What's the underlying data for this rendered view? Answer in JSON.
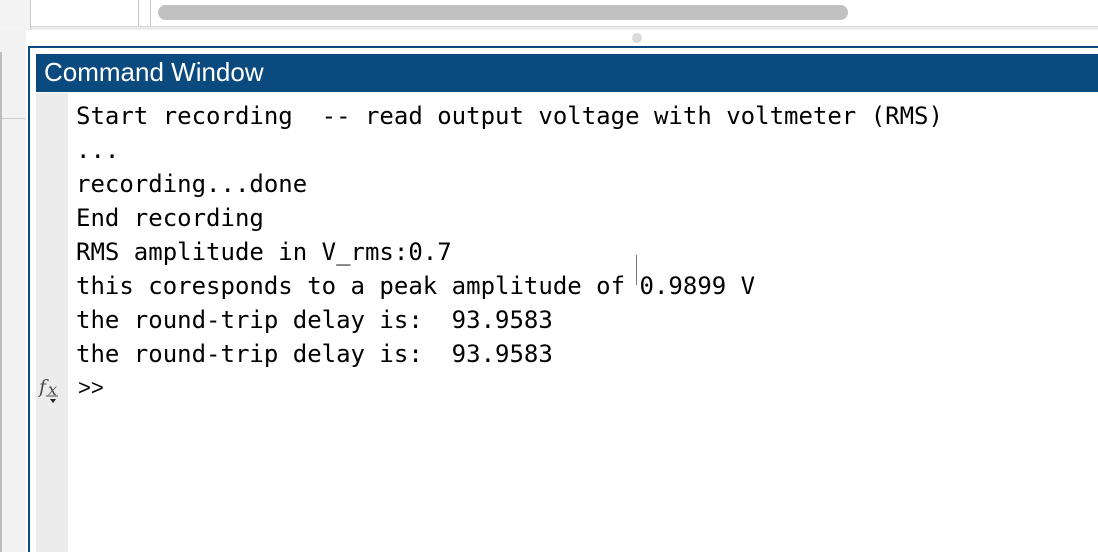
{
  "command_window": {
    "title": "Command Window",
    "lines": [
      "Start recording  -- read output voltage with voltmeter (RMS)",
      "...",
      "recording...done",
      "End recording",
      "RMS amplitude in V_rms:0.7",
      "this coresponds to a peak amplitude of 0.9899 V",
      "the round-trip delay is:  93.9583",
      "the round-trip delay is:  93.9583"
    ],
    "prompt": ">>",
    "function_icon": "fx-icon"
  },
  "colors": {
    "title_bar": "#0b4a7e",
    "title_text": "#ffffff",
    "scrollbar": "#c1c1c1"
  }
}
